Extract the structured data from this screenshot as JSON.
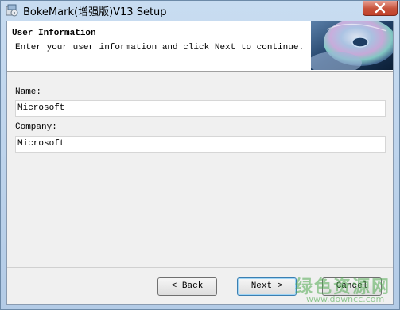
{
  "window": {
    "title": "BokeMark(增强版)V13 Setup"
  },
  "header": {
    "title": "User Information",
    "subtitle": "Enter your user information and click Next to continue."
  },
  "form": {
    "name_label": "Name:",
    "name_value": "Microsoft",
    "company_label": "Company:",
    "company_value": "Microsoft"
  },
  "buttons": {
    "back_label": "Back",
    "back_arrow": "<",
    "next_label": "Next",
    "next_arrow": ">",
    "cancel_label": "Cancel"
  },
  "watermark": {
    "text": "绿色资源网",
    "url": "www.downcc.com"
  },
  "icons": {
    "app": "setup-icon",
    "close": "close-icon",
    "header_art": "cd-disc-image"
  }
}
